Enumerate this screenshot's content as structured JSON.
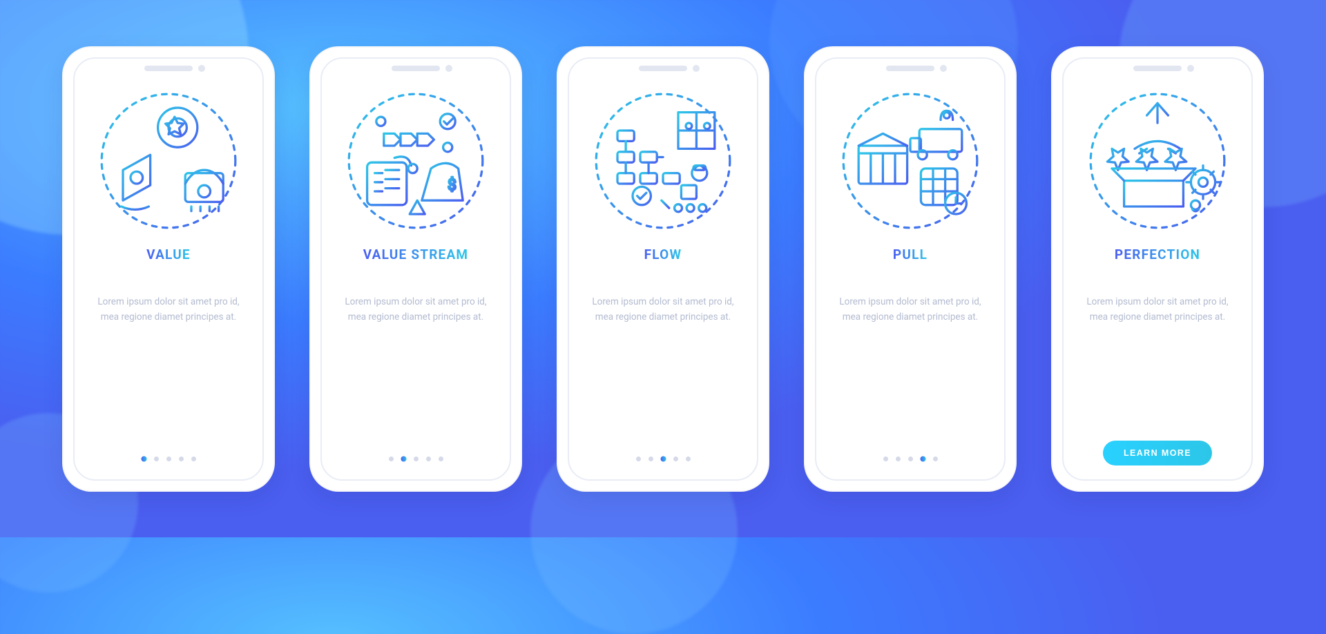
{
  "colors": {
    "gradStart": "#4a5ef0",
    "gradEnd": "#2cc6e8",
    "muted": "#b3bbd0"
  },
  "screens": [
    {
      "title": "VALUE",
      "desc": "Lorem ipsum dolor sit amet pro id, mea regione diamet principes at.",
      "icon": "value-icon",
      "activeIndex": 0,
      "cta": null
    },
    {
      "title": "VALUE STREAM",
      "desc": "Lorem ipsum dolor sit amet pro id, mea regione diamet principes at.",
      "icon": "value-stream-icon",
      "activeIndex": 1,
      "cta": null
    },
    {
      "title": "FLOW",
      "desc": "Lorem ipsum dolor sit amet pro id, mea regione diamet principes at.",
      "icon": "flow-icon",
      "activeIndex": 2,
      "cta": null
    },
    {
      "title": "PULL",
      "desc": "Lorem ipsum dolor sit amet pro id, mea regione diamet principes at.",
      "icon": "pull-icon",
      "activeIndex": 3,
      "cta": null
    },
    {
      "title": "PERFECTION",
      "desc": "Lorem ipsum dolor sit amet pro id, mea regione diamet principes at.",
      "icon": "perfection-icon",
      "activeIndex": 4,
      "cta": "LEARN MORE"
    }
  ],
  "totalDots": 5
}
